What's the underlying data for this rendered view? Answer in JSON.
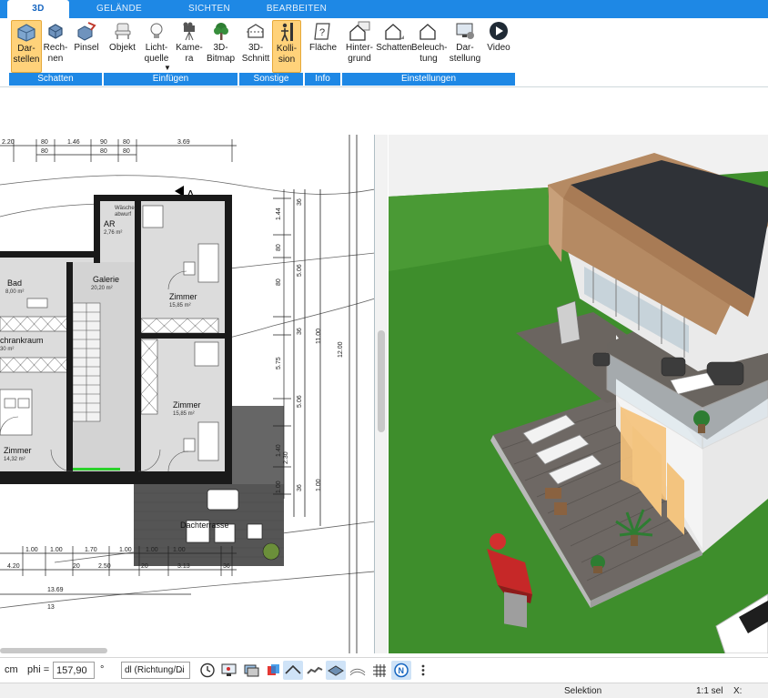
{
  "tabs": [
    "3D",
    "GELÄNDE",
    "SICHTEN",
    "BEARBEITEN"
  ],
  "ribbon": {
    "buttons": [
      {
        "label": "Dar-\nstellen",
        "icon": "cube-display-icon"
      },
      {
        "label": "Rech-\nnen",
        "icon": "cube-calc-icon"
      },
      {
        "label": "Pinsel",
        "icon": "brush-cube-icon"
      },
      {
        "label": "Objekt",
        "icon": "chair-icon"
      },
      {
        "label": "Licht-\nquelle",
        "icon": "lightbulb-icon"
      },
      {
        "label": "Kame-\nra",
        "icon": "camera-icon"
      },
      {
        "label": "3D-\nBitmap",
        "icon": "tree-icon"
      },
      {
        "label": "3D-\nSchnitt",
        "icon": "section-icon"
      },
      {
        "label": "Kolli-\nsion",
        "icon": "person-collision-icon"
      },
      {
        "label": "Fläche",
        "icon": "area-question-icon"
      },
      {
        "label": "Hinter-\ngrund",
        "icon": "house-background-icon"
      },
      {
        "label": "Schatten",
        "icon": "house-shadow-icon"
      },
      {
        "label": "Beleuch-\ntung",
        "icon": "house-light-icon"
      },
      {
        "label": "Dar-\nstellung",
        "icon": "monitor-settings-icon"
      },
      {
        "label": "Video",
        "icon": "play-icon"
      }
    ],
    "groups": [
      "Schatten",
      "Einfügen",
      "Sonstige",
      "Info",
      "Einstellungen"
    ]
  },
  "plan": {
    "top_dims": [
      "2.20",
      "80",
      "1.46",
      "90",
      "80",
      "3.69"
    ],
    "top_dims2": [
      "80",
      "80",
      "80"
    ],
    "right_dims_inner": [
      "36",
      "1.44",
      "80",
      "5.06",
      "80",
      "5.75",
      "5.06",
      "36",
      "36"
    ],
    "right_dims_outer": [
      "11.00",
      "12.00",
      "1.00",
      "2.30",
      "1.40",
      "1.00"
    ],
    "bottom_dims": [
      "1.00",
      "1.00",
      "1.70",
      "1.00",
      "1.00",
      "1.00"
    ],
    "bottom_dims2": [
      "4.20",
      "20",
      "2.50",
      "20",
      "3.13",
      "36"
    ],
    "bottom_total": "13.69",
    "bottom_total2": "13",
    "section_mark": "A",
    "rooms": [
      {
        "name": "AR",
        "area": "2,76 m²"
      },
      {
        "name": "Bad",
        "area": "8,00 m²"
      },
      {
        "name": "Galerie",
        "area": "20,20 m²"
      },
      {
        "name": "Zimmer",
        "area": "15,85 m²"
      },
      {
        "name": "chrankraum",
        "area": "30 m²"
      },
      {
        "name": "Zimmer",
        "area": "15,85 m²"
      },
      {
        "name": "Zimmer",
        "area": "14,32 m²"
      },
      {
        "name": "Dachterrasse",
        "area": ""
      }
    ],
    "washer_label": "Wäsche-\nabwurf"
  },
  "bottombar": {
    "unit": "cm",
    "phi_label": "phi =",
    "phi_value": "157,90",
    "degree": "°",
    "mode_select": "dl (Richtung/Di",
    "icons": [
      "clock-icon",
      "monitor-icon",
      "layers-icon",
      "paint-bucket-icon",
      "roof-icon",
      "stairs-icon",
      "floor-icon",
      "terrain-icon",
      "grid-icon",
      "north-icon",
      "more-icon"
    ]
  },
  "status": {
    "mode": "Selektion",
    "scale": "1:1 sel",
    "coord": "X:"
  },
  "colors": {
    "accent": "#1e88e5",
    "active_button": "#ffd27a",
    "lawn": "#3e8e2c",
    "deck": "#6e6864",
    "roof": "#2f3237",
    "wood": "#b58a63"
  }
}
